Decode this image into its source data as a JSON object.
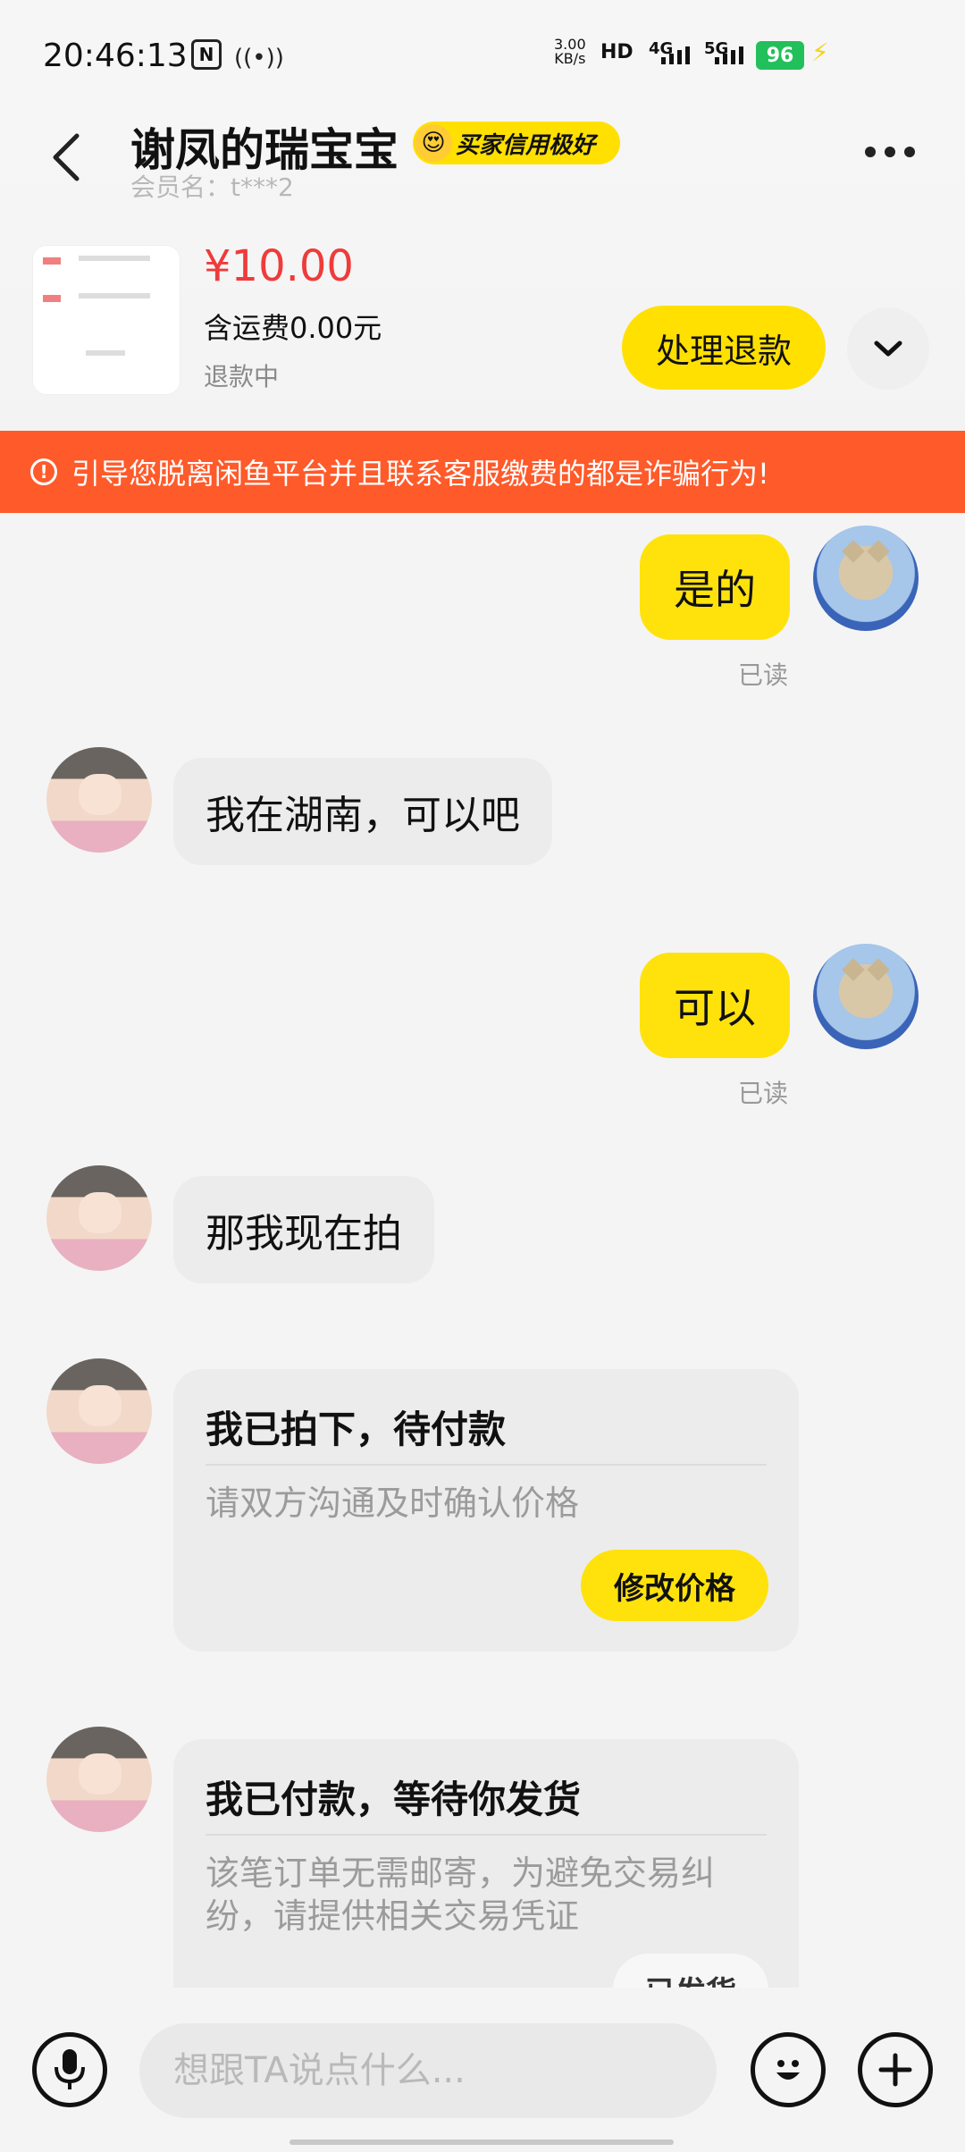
{
  "status_bar": {
    "time": "20:46:13",
    "net_speed_value": "3.00",
    "net_speed_unit": "KB/s",
    "hd_label": "HD",
    "sim1_network": "4G",
    "sim2_network": "5G",
    "battery": "96"
  },
  "header": {
    "title": "谢凤的瑞宝宝",
    "badge_text": "买家信用极好",
    "member_name": "会员名：t***2"
  },
  "product": {
    "price": "¥10.00",
    "shipping": "含运费0.00元",
    "status": "退款中",
    "refund_button": "处理退款"
  },
  "warning": {
    "text": "引导您脱离闲鱼平台并且联系客服缴费的都是诈骗行为!"
  },
  "messages": [
    {
      "from": "me",
      "text": "是的",
      "status": "已读"
    },
    {
      "from": "them",
      "text": "我在湖南，可以吧"
    },
    {
      "from": "me",
      "text": "可以",
      "status": "已读"
    },
    {
      "from": "them",
      "text": "那我现在拍"
    }
  ],
  "cards": [
    {
      "title": "我已拍下，待付款",
      "desc": "请双方沟通及时确认价格",
      "button": "修改价格"
    },
    {
      "title": "我已付款，等待你发货",
      "desc": "该笔订单无需邮寄，为避免交易纠纷，请提供相关交易凭证",
      "button": "已发货"
    }
  ],
  "input": {
    "placeholder": "想跟TA说点什么..."
  },
  "colors": {
    "accent_yellow": "#ffe20c",
    "warning_orange": "#ff5a2a",
    "price_red": "#ef3b3b",
    "battery_green": "#21c05a"
  }
}
